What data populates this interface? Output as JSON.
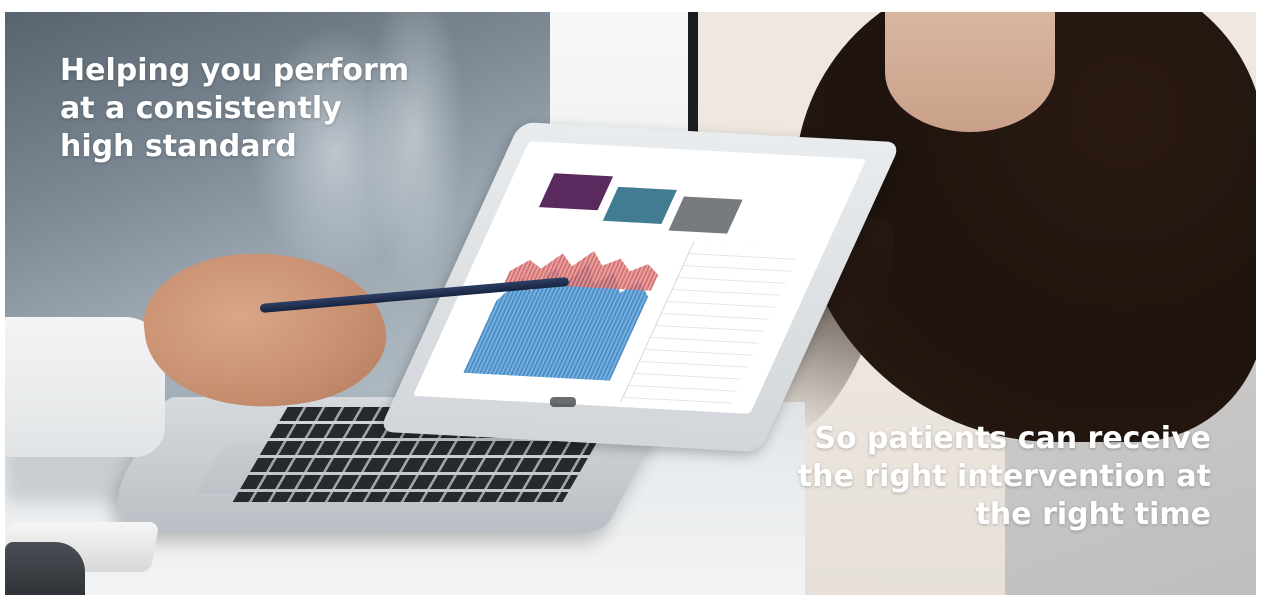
{
  "captions": {
    "top": {
      "lines": [
        "Helping you perform",
        "at a consistently",
        "high standard"
      ]
    },
    "bottom": {
      "lines": [
        "So patients can receive",
        "the right intervention at",
        "the right time"
      ]
    }
  },
  "colors": {
    "caption_text": "#ffffff",
    "dashboard_tile_purple": "#5a2a5e",
    "dashboard_tile_teal": "#417c92",
    "dashboard_tile_gray": "#777a7e"
  }
}
